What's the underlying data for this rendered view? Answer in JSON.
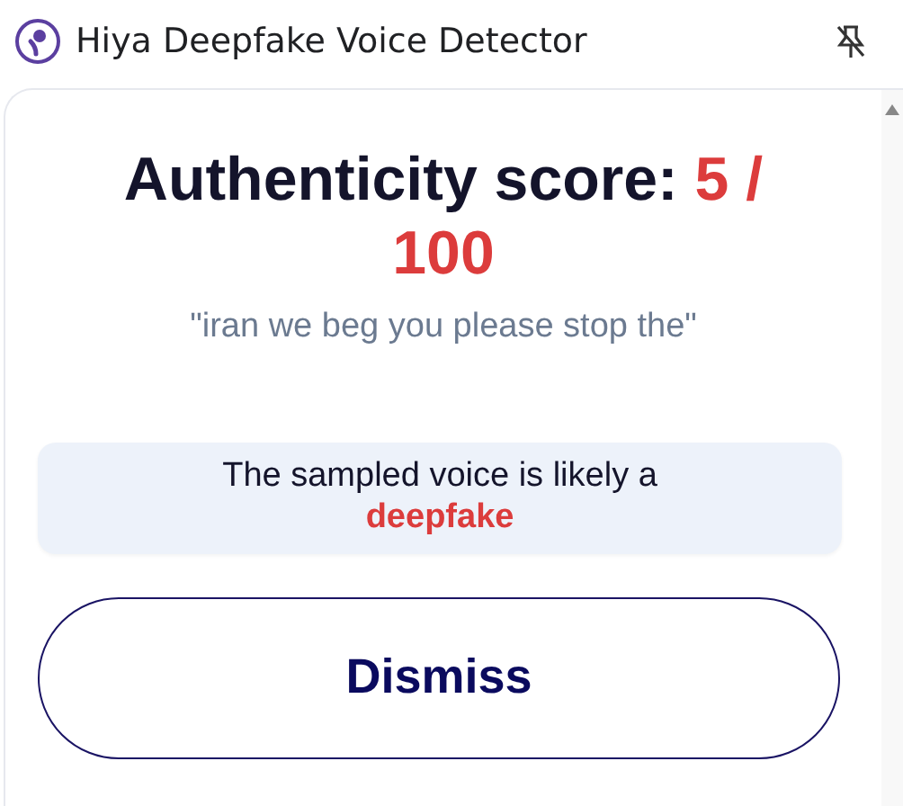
{
  "window": {
    "title": "Hiya Deepfake Voice Detector"
  },
  "score": {
    "label": "Authenticity score:",
    "value": "5 / 100"
  },
  "transcript": "\"iran we beg you please stop the\"",
  "verdict": {
    "text": "The sampled voice is likely a",
    "result": "deepfake",
    "kind": "deepfake"
  },
  "buttons": [
    {
      "label": "Dismiss"
    }
  ]
}
